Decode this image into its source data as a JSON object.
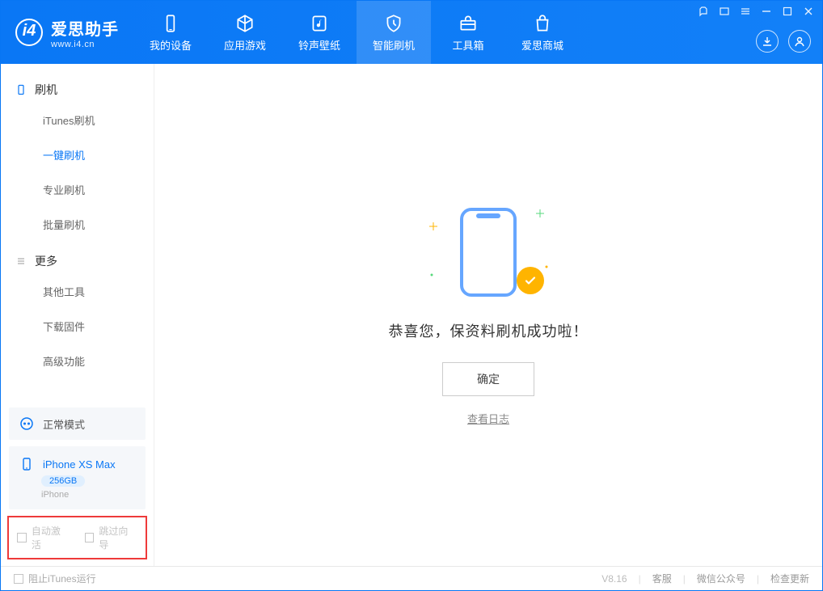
{
  "logo": {
    "name": "爱思助手",
    "url": "www.i4.cn"
  },
  "tabs": [
    {
      "label": "我的设备"
    },
    {
      "label": "应用游戏"
    },
    {
      "label": "铃声壁纸"
    },
    {
      "label": "智能刷机"
    },
    {
      "label": "工具箱"
    },
    {
      "label": "爱思商城"
    }
  ],
  "sidebar": {
    "section1": "刷机",
    "items1": [
      {
        "label": "iTunes刷机"
      },
      {
        "label": "一键刷机"
      },
      {
        "label": "专业刷机"
      },
      {
        "label": "批量刷机"
      }
    ],
    "section2": "更多",
    "items2": [
      {
        "label": "其他工具"
      },
      {
        "label": "下载固件"
      },
      {
        "label": "高级功能"
      }
    ]
  },
  "mode": {
    "label": "正常模式"
  },
  "device": {
    "name": "iPhone XS Max",
    "capacity": "256GB",
    "type": "iPhone"
  },
  "options": {
    "auto_activate": "自动激活",
    "skip_guide": "跳过向导"
  },
  "main": {
    "success_msg": "恭喜您，保资料刷机成功啦！",
    "ok": "确定",
    "view_log": "查看日志"
  },
  "footer": {
    "block_itunes": "阻止iTunes运行",
    "version": "V8.16",
    "support": "客服",
    "wechat": "微信公众号",
    "update": "检查更新"
  }
}
